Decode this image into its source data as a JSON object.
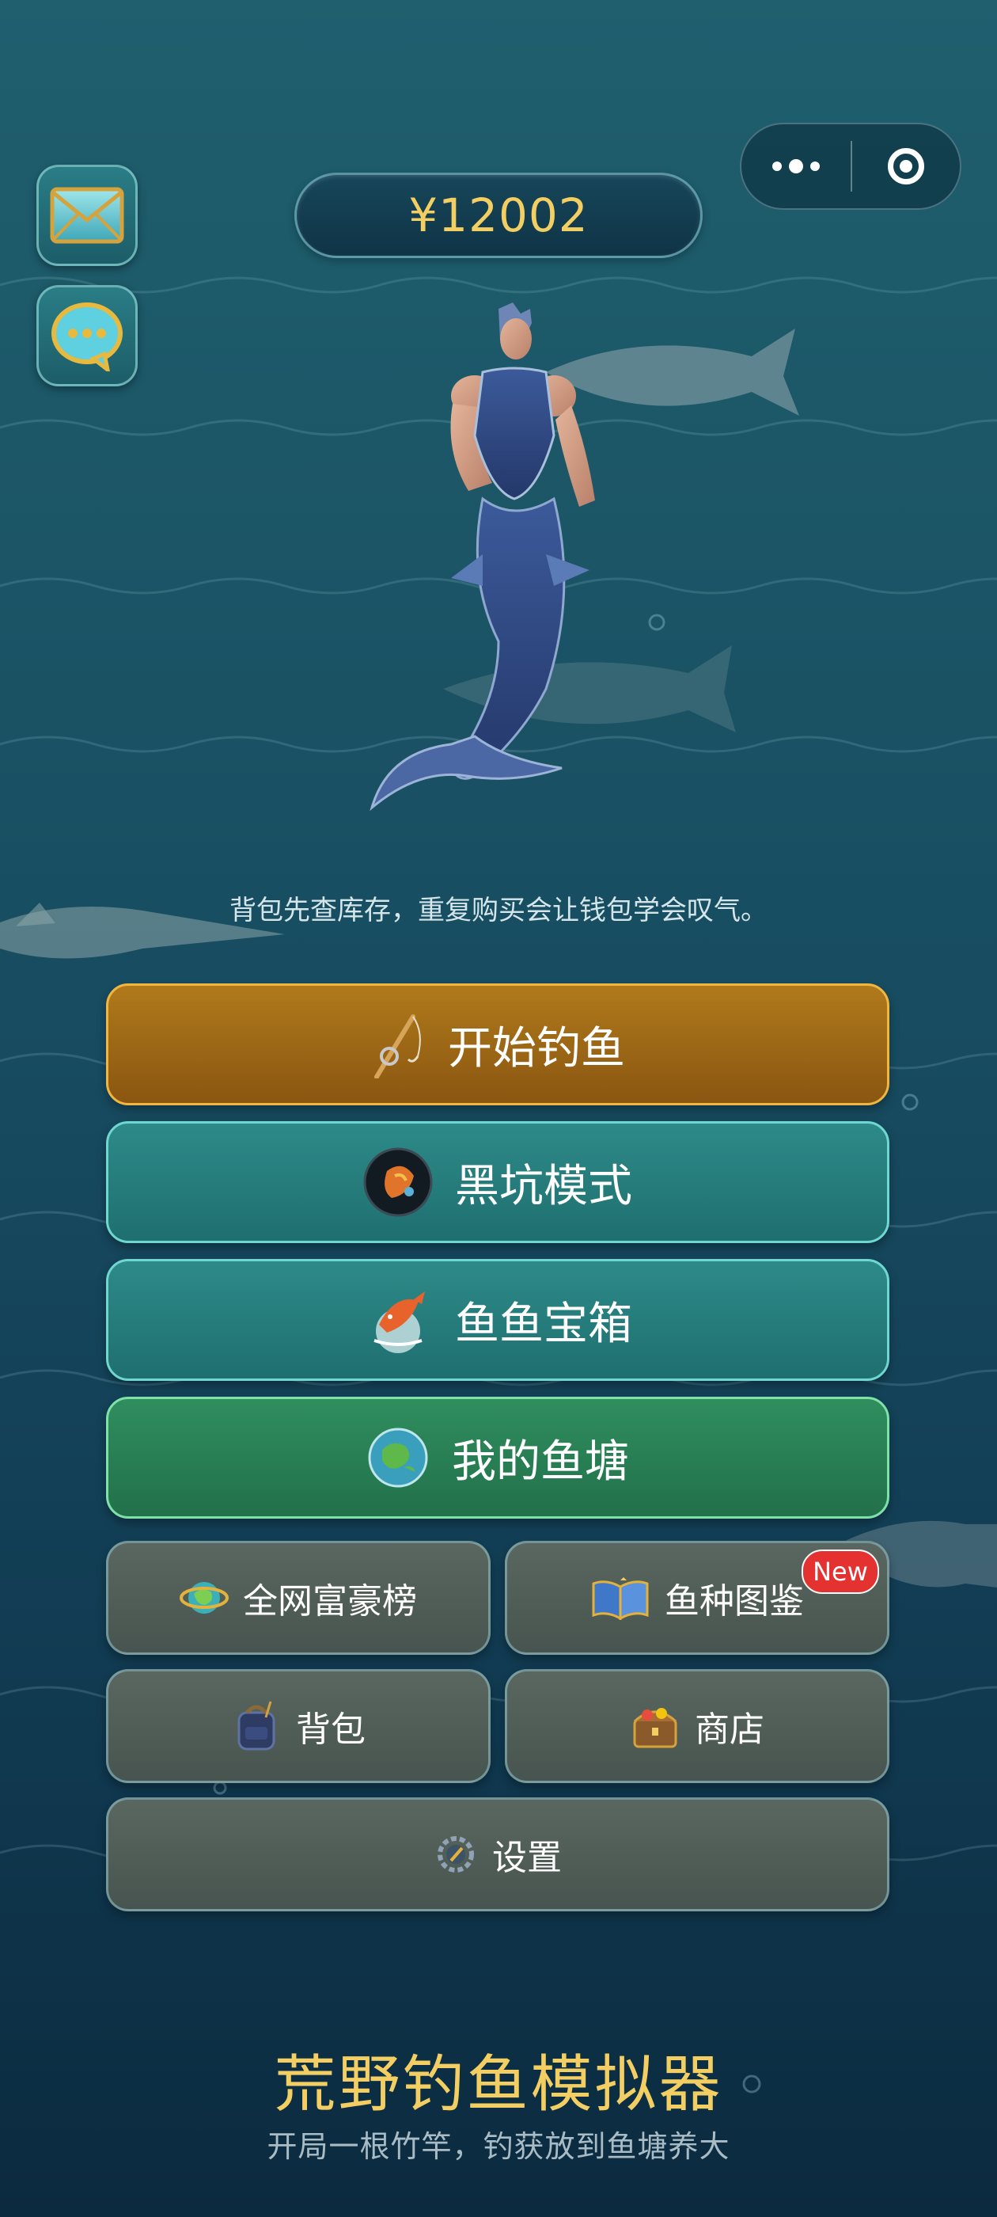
{
  "header": {
    "money": "¥12002",
    "capsule": {
      "more_icon": "more-dots-icon",
      "close_icon": "target-close-icon"
    },
    "side_buttons": [
      {
        "icon": "mail-icon"
      },
      {
        "icon": "chat-bubble-icon"
      }
    ]
  },
  "hero": {
    "character": "mermaid-warrior-illustration"
  },
  "tip": "背包先查库存，重复购买会让钱包学会叹气。",
  "main_buttons": [
    {
      "label": "开始钓鱼",
      "icon": "fishing-rod-icon",
      "color": "#a06b16"
    },
    {
      "label": "黑坑模式",
      "icon": "black-pit-icon",
      "color": "#2a8482"
    },
    {
      "label": "鱼鱼宝箱",
      "icon": "koi-fish-icon",
      "color": "#2a8482"
    },
    {
      "label": "我的鱼塘",
      "icon": "pond-globe-icon",
      "color": "#2a8a58"
    }
  ],
  "grid_buttons": [
    {
      "label": "全网富豪榜",
      "icon": "globe-ranking-icon"
    },
    {
      "label": "鱼种图鉴",
      "icon": "open-book-icon",
      "badge": "New"
    },
    {
      "label": "背包",
      "icon": "backpack-icon"
    },
    {
      "label": "商店",
      "icon": "treasure-chest-icon"
    }
  ],
  "settings": {
    "label": "设置",
    "icon": "gear-compass-icon"
  },
  "footer": {
    "title": "荒野钓鱼模拟器",
    "subtitle": "开局一根竹竿，钓获放到鱼塘养大"
  },
  "colors": {
    "gold_text": "#f3cf63",
    "badge_red": "#e3322f"
  }
}
